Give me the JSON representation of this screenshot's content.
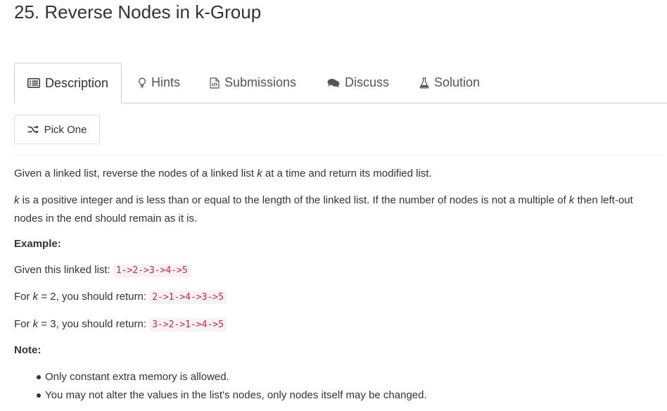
{
  "problem": {
    "title": "25. Reverse Nodes in k-Group"
  },
  "tabs": [
    {
      "label": "Description",
      "icon": "list-alt-icon",
      "active": true
    },
    {
      "label": "Hints",
      "icon": "lightbulb-icon"
    },
    {
      "label": "Submissions",
      "icon": "code-file-icon"
    },
    {
      "label": "Discuss",
      "icon": "comments-icon"
    },
    {
      "label": "Solution",
      "icon": "flask-icon"
    }
  ],
  "pick_one": {
    "label": "Pick One",
    "icon": "random-icon"
  },
  "description": {
    "intro_before_k": "Given a linked list, reverse the nodes of a linked list ",
    "k": "k",
    "intro_after_k": " at a time and return its modified list.",
    "para2_part1": " is a positive integer and is less than or equal to the length of the linked list. If the number of nodes is not a multiple of ",
    "para2_part2": " then left-out nodes in the end should remain as it is.",
    "example_heading": "Example:",
    "given_label": "Given this linked list: ",
    "given_value": "1->2->3->4->5",
    "k2_prefix": "For ",
    "k2_suffix": " = 2, you should return: ",
    "k2_value": "2->1->4->3->5",
    "k3_prefix": "For ",
    "k3_suffix": " = 3, you should return: ",
    "k3_value": "3->2->1->4->5",
    "note_heading": "Note:",
    "notes": [
      "Only constant extra memory is allowed.",
      "You may not alter the values in the list's nodes, only nodes itself may be changed."
    ]
  },
  "colors": {
    "code_text": "#c7254e",
    "code_bg": "#f9f2f4",
    "border": "#cccccc"
  }
}
